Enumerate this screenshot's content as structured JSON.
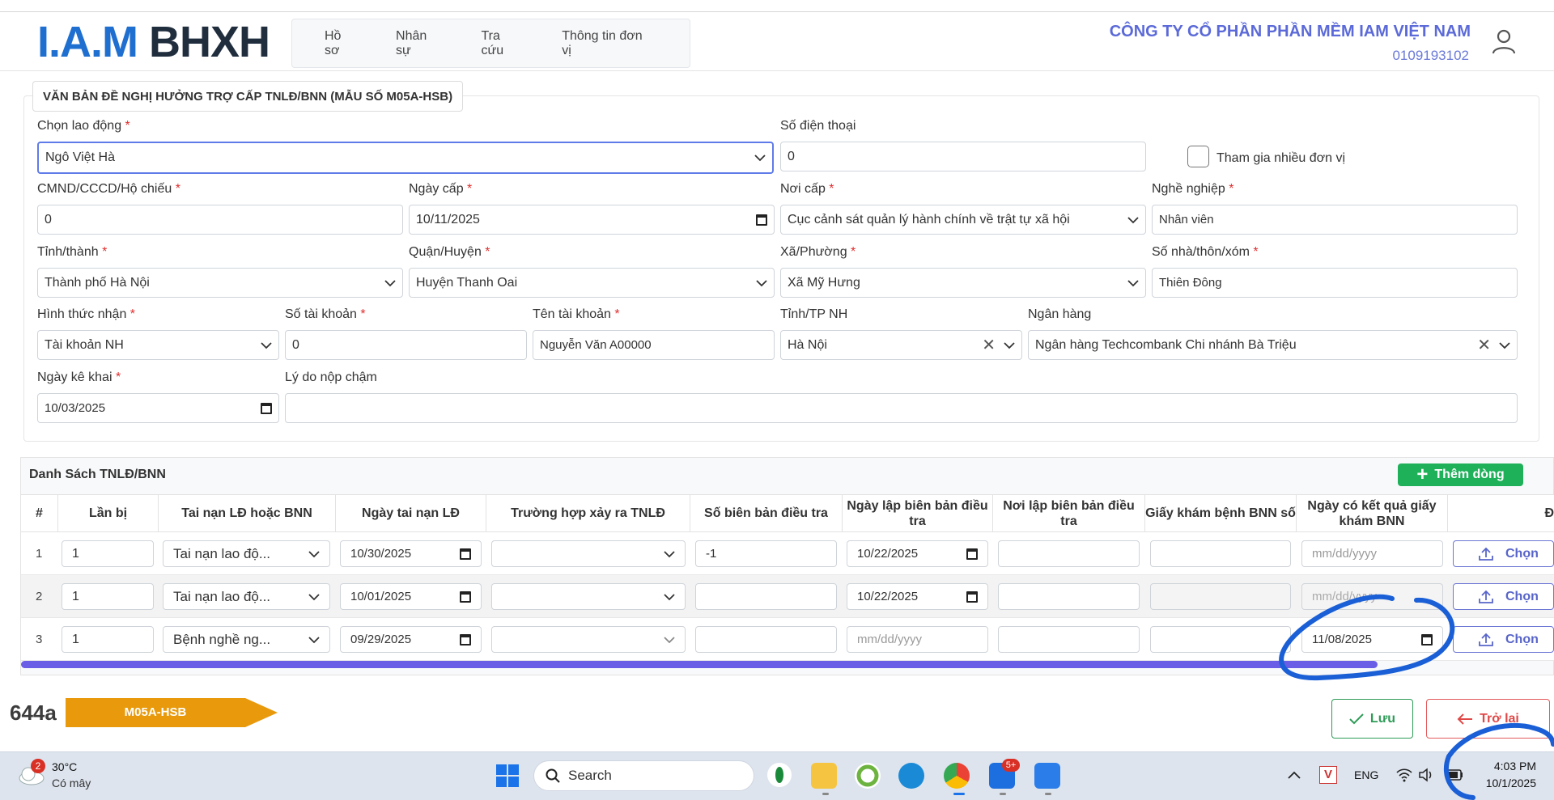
{
  "header": {
    "logo_part1": "I.A.M",
    "logo_part2": "BHXH",
    "nav": [
      "Hồ sơ",
      "Nhân sự",
      "Tra cứu",
      "Thông tin đơn vị"
    ],
    "company_name": "CÔNG TY CỔ PHẦN PHẦN MỀM IAM VIỆT NAM",
    "tax_code": "0109193102"
  },
  "form": {
    "section_title": "VĂN BẢN ĐỀ NGHỊ HƯỞNG TRỢ CẤP TNLĐ/BNN (MẪU SỐ M05A-HSB)",
    "required_mark": "*",
    "chon_lao_dong": {
      "label": "Chọn lao động",
      "value": "Ngô Việt Hà"
    },
    "so_dien_thoai": {
      "label": "Số điện thoại",
      "value": "0"
    },
    "tham_gia": {
      "label": "Tham gia nhiều đơn vị",
      "checked": false
    },
    "cmnd": {
      "label": "CMND/CCCD/Hộ chiếu",
      "value": "0"
    },
    "ngay_cap": {
      "label": "Ngày cấp",
      "value": "10/11/2025"
    },
    "noi_cap": {
      "label": "Nơi cấp",
      "value": "Cục cảnh sát quản lý hành chính về trật tự xã hội"
    },
    "nghe_nghiep": {
      "label": "Nghề nghiệp",
      "value": "Nhân viên"
    },
    "tinh_thanh": {
      "label": "Tỉnh/thành",
      "value": "Thành phố Hà Nội"
    },
    "quan_huyen": {
      "label": "Quận/Huyện",
      "value": "Huyện Thanh Oai"
    },
    "xa_phuong": {
      "label": "Xã/Phường",
      "value": "Xã Mỹ Hưng"
    },
    "so_nha": {
      "label": "Số nhà/thôn/xóm",
      "value": "Thiên Đông"
    },
    "hinh_thuc_nhan": {
      "label": "Hình thức nhận",
      "value": "Tài khoản NH"
    },
    "so_tai_khoan": {
      "label": "Số tài khoản",
      "value": "0"
    },
    "ten_tai_khoan": {
      "label": "Tên tài khoản",
      "value": "Nguyễn Văn A00000"
    },
    "tinh_tp_nh": {
      "label": "Tỉnh/TP NH",
      "value": "Hà Nội"
    },
    "ngan_hang": {
      "label": "Ngân hàng",
      "value": "Ngân hàng Techcombank Chi nhánh Bà Triệu"
    },
    "ngay_ke_khai": {
      "label": "Ngày kê khai",
      "value": "10/03/2025"
    },
    "ly_do_nop_cham": {
      "label": "Lý do nộp chậm",
      "value": ""
    }
  },
  "table": {
    "title": "Danh Sách TNLĐ/BNN",
    "add_label": "Thêm dòng",
    "date_placeholder": "mm/dd/yyyy",
    "columns": [
      "#",
      "Lần bị",
      "Tai nạn LĐ hoặc BNN",
      "Ngày tai nạn LĐ",
      "Trường hợp xảy ra TNLĐ",
      "Số biên bản điều tra",
      "Ngày lập biên bản điều tra",
      "Nơi lập biên bản điều tra",
      "Giấy khám bệnh BNN số",
      "Ngày có kết quả giấy khám BNN",
      "Đ"
    ],
    "rows": [
      {
        "num": "1",
        "lan_bi": "1",
        "loai": "Tai nạn lao độ...",
        "ngay_tai_nan": "10/30/2025",
        "truong_hop": "",
        "so_bien_ban": "-1",
        "ngay_lap": "10/22/2025",
        "noi_lap": "",
        "giay_kham": "",
        "ngay_ket_qua": "",
        "chon": "Chọn"
      },
      {
        "num": "2",
        "lan_bi": "1",
        "loai": "Tai nạn lao độ...",
        "ngay_tai_nan": "10/01/2025",
        "truong_hop": "",
        "so_bien_ban": "",
        "ngay_lap": "10/22/2025",
        "noi_lap": "",
        "giay_kham": "",
        "ngay_ket_qua": "",
        "chon": "Chọn"
      },
      {
        "num": "3",
        "lan_bi": "1",
        "loai": "Bệnh nghề ng...",
        "ngay_tai_nan": "09/29/2025",
        "truong_hop": "",
        "so_bien_ban": "",
        "ngay_lap": "",
        "noi_lap": "",
        "giay_kham": "",
        "ngay_ket_qua": "11/08/2025",
        "chon": "Chọn"
      }
    ]
  },
  "footer": {
    "doc_number": "644a",
    "form_tag": "M05A-HSB",
    "save_label": "Lưu",
    "back_label": "Trở lại"
  },
  "taskbar": {
    "weather_badge": "2",
    "temperature": "30°C",
    "weather_desc": "Có mây",
    "search_label": "Search",
    "zalo_badge": "5+",
    "language": "ENG",
    "time": "4:03 PM",
    "date": "10/1/2025"
  },
  "colors": {
    "brand_blue": "#1e6fd0",
    "accent_purple": "#5b6ad8",
    "add_green": "#1fb05a",
    "tag_orange": "#e89a0c",
    "annotation_blue": "#1a5fd6"
  }
}
